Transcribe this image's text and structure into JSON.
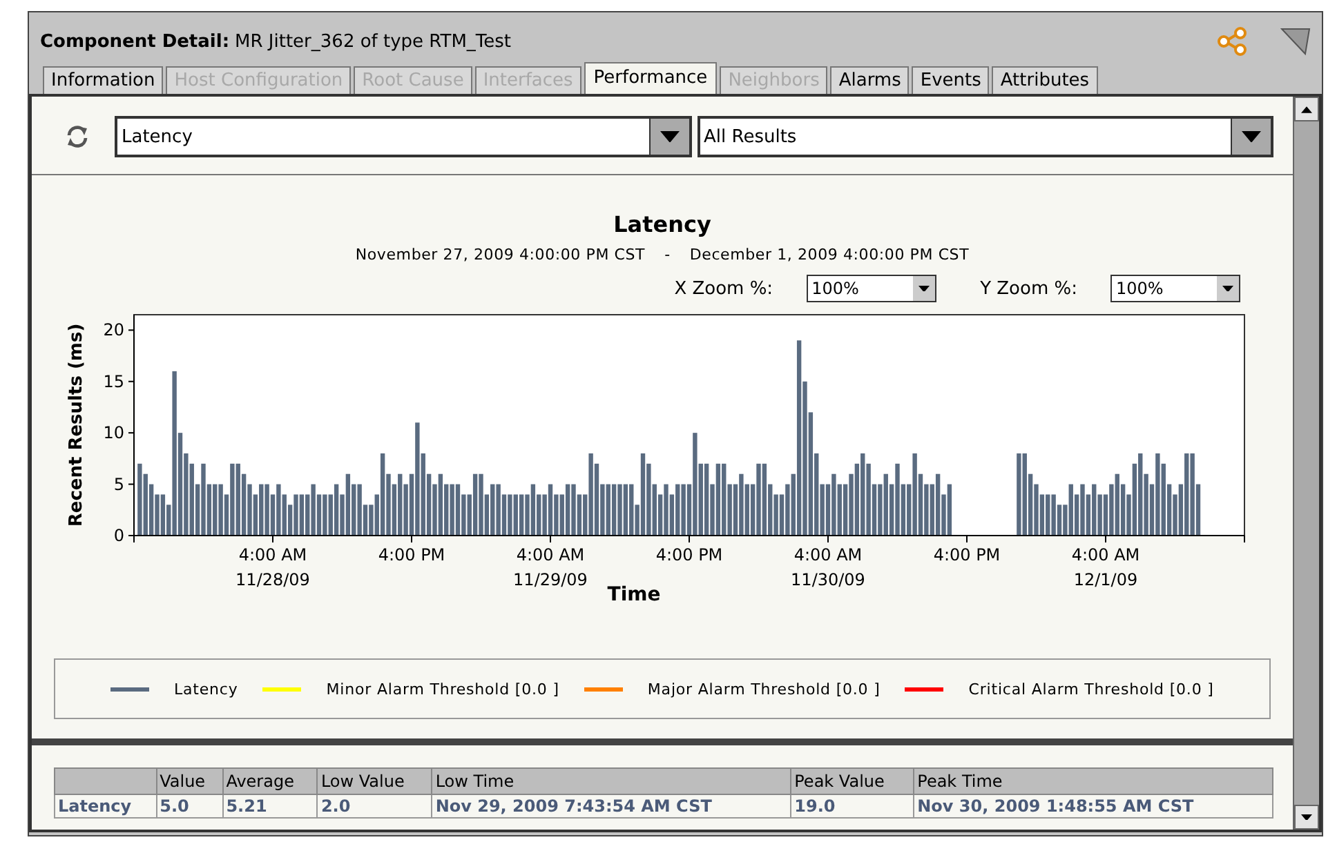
{
  "window": {
    "title_label": "Component Detail:",
    "title": "MR Jitter_362 of type RTM_Test"
  },
  "tabs": [
    {
      "label": "Information",
      "selected": false,
      "disabled": false
    },
    {
      "label": "Host Configuration",
      "selected": false,
      "disabled": true
    },
    {
      "label": "Root Cause",
      "selected": false,
      "disabled": true
    },
    {
      "label": "Interfaces",
      "selected": false,
      "disabled": true
    },
    {
      "label": "Performance",
      "selected": true,
      "disabled": false
    },
    {
      "label": "Neighbors",
      "selected": false,
      "disabled": true
    },
    {
      "label": "Alarms",
      "selected": false,
      "disabled": false
    },
    {
      "label": "Events",
      "selected": false,
      "disabled": false
    },
    {
      "label": "Attributes",
      "selected": false,
      "disabled": false
    }
  ],
  "toolbar": {
    "metric": "Latency",
    "filter": "All Results"
  },
  "chart": {
    "subtitle_start": "November 27, 2009 4:00:00 PM CST",
    "separator": "-",
    "subtitle_end": "December 1, 2009 4:00:00 PM CST",
    "x_zoom": {
      "label": "X Zoom %:",
      "value": "100%"
    },
    "y_zoom": {
      "label": "Y Zoom %:",
      "value": "100%"
    },
    "chart_data": {
      "type": "bar",
      "title": "Latency",
      "xlabel": "Time",
      "ylabel": "Recent Results (ms)",
      "ylim": [
        0,
        21.5
      ],
      "categories": [
        null,
        null,
        null,
        null,
        null,
        null,
        null,
        null,
        null,
        null,
        null,
        null,
        null,
        null,
        null,
        null,
        null,
        null,
        null,
        null,
        null,
        null,
        null,
        null,
        "4:00 AM\n11/28/09",
        null,
        null,
        null,
        null,
        null,
        null,
        null,
        null,
        null,
        null,
        null,
        null,
        null,
        null,
        null,
        null,
        null,
        null,
        null,
        null,
        null,
        null,
        null,
        "4:00 PM",
        null,
        null,
        null,
        null,
        null,
        null,
        null,
        null,
        null,
        null,
        null,
        null,
        null,
        null,
        null,
        null,
        null,
        null,
        null,
        null,
        null,
        null,
        null,
        "4:00 AM\n11/29/09",
        null,
        null,
        null,
        null,
        null,
        null,
        null,
        null,
        null,
        null,
        null,
        null,
        null,
        null,
        null,
        null,
        null,
        null,
        null,
        null,
        null,
        null,
        null,
        "4:00 PM",
        null,
        null,
        null,
        null,
        null,
        null,
        null,
        null,
        null,
        null,
        null,
        null,
        null,
        null,
        null,
        null,
        null,
        null,
        null,
        null,
        null,
        null,
        null,
        "4:00 AM\n11/30/09",
        null,
        null,
        null,
        null,
        null,
        null,
        null,
        null,
        null,
        null,
        null,
        null,
        null,
        null,
        null,
        null,
        null,
        null,
        null,
        null,
        null,
        null,
        null,
        "4:00 PM",
        null,
        null,
        null,
        null,
        null,
        null,
        null,
        null,
        null,
        null,
        null,
        null,
        null,
        null,
        null,
        null,
        null,
        null,
        null,
        null,
        null,
        null,
        null,
        "4:00 AM\n12/1/09",
        null,
        null,
        null,
        null,
        null,
        null,
        null,
        null,
        null,
        null,
        null,
        null,
        null,
        null,
        null,
        null,
        null,
        null,
        null,
        null,
        null,
        null,
        null
      ],
      "series": [
        {
          "name": "Latency",
          "color": "#5a6b80",
          "values": [
            null,
            7,
            6,
            5,
            4,
            4,
            3,
            16,
            10,
            8,
            7,
            5,
            7,
            5,
            5,
            5,
            4,
            7,
            7,
            6,
            5,
            4,
            5,
            5,
            4,
            5,
            4,
            3,
            4,
            4,
            4,
            5,
            4,
            4,
            4,
            5,
            4,
            6,
            5,
            5,
            3,
            3,
            4,
            8,
            6,
            5,
            6,
            5,
            6,
            11,
            8,
            6,
            5,
            6,
            5,
            5,
            5,
            4,
            4,
            6,
            6,
            4,
            5,
            5,
            4,
            4,
            4,
            4,
            4,
            5,
            4,
            4,
            5,
            4,
            4,
            5,
            5,
            4,
            4,
            8,
            7,
            5,
            5,
            5,
            5,
            5,
            5,
            3,
            8,
            7,
            5,
            4,
            5,
            4,
            5,
            5,
            5,
            10,
            7,
            7,
            5,
            7,
            7,
            5,
            5,
            6,
            5,
            5,
            7,
            7,
            5,
            4,
            4,
            5,
            6,
            19,
            15,
            12,
            8,
            5,
            5,
            6,
            5,
            5,
            6,
            7,
            8,
            7,
            5,
            5,
            6,
            5,
            7,
            5,
            5,
            8,
            6,
            5,
            5,
            6,
            4,
            5,
            null,
            null,
            null,
            null,
            null,
            null,
            null,
            null,
            null,
            null,
            null,
            8,
            8,
            6,
            5,
            4,
            4,
            4,
            3,
            3,
            5,
            4,
            5,
            4,
            5,
            4,
            4,
            5,
            6,
            5,
            4,
            7,
            8,
            6,
            5,
            8,
            7,
            5,
            4,
            5,
            8,
            8,
            5,
            null,
            null,
            null,
            null,
            null,
            null,
            null
          ]
        }
      ],
      "yticks": [
        0,
        5,
        10,
        15,
        20
      ]
    },
    "thresholds": [
      {
        "label": "Minor Alarm Threshold [0.0 ]",
        "color": "#ffff00"
      },
      {
        "label": "Major Alarm Threshold [0.0 ]",
        "color": "#ff8000"
      },
      {
        "label": "Critical Alarm Threshold [0.0 ]",
        "color": "#ff0000"
      }
    ]
  },
  "table": {
    "columns": [
      "",
      "Value",
      "Average",
      "Low Value",
      "Low Time",
      "Peak Value",
      "Peak Time"
    ],
    "rows": [
      [
        "Latency",
        "5.0",
        "5.21",
        "2.0",
        "Nov 29, 2009 7:43:54 AM CST",
        "19.0",
        "Nov 30, 2009 1:48:55 AM CST"
      ]
    ]
  }
}
